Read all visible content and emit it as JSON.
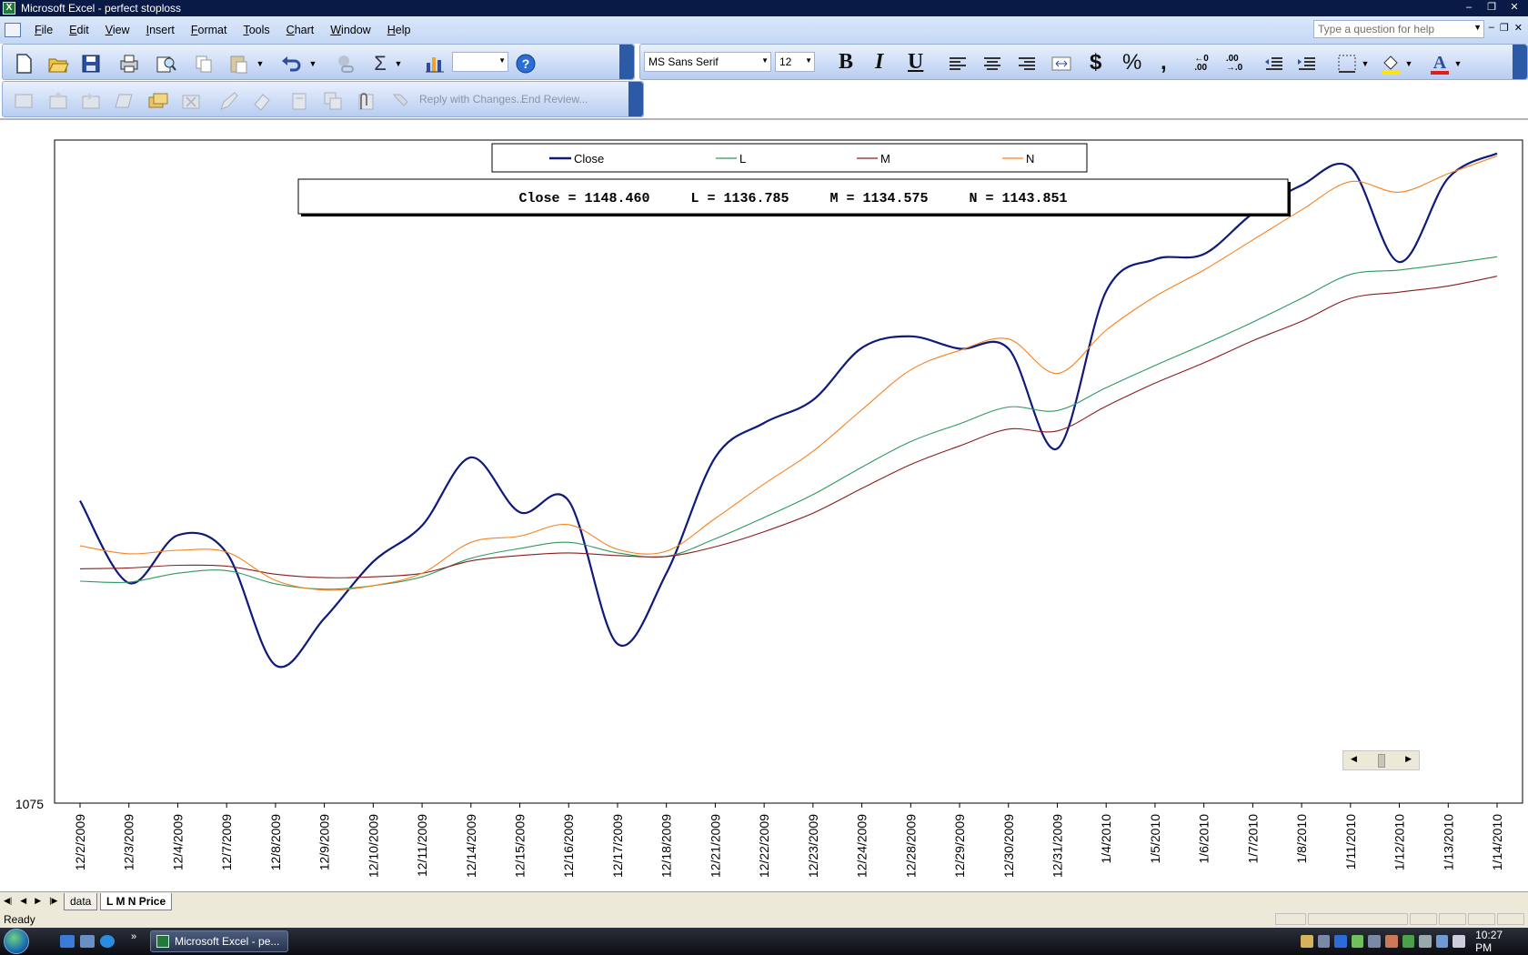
{
  "window": {
    "title": "Microsoft Excel - perfect stoploss"
  },
  "menu": [
    "File",
    "Edit",
    "View",
    "Insert",
    "Format",
    "Tools",
    "Chart",
    "Window",
    "Help"
  ],
  "help_box": {
    "placeholder": "Type a question for help"
  },
  "formatting": {
    "font_name": "MS Sans Serif",
    "font_size": "12",
    "bold": "B",
    "italic": "I",
    "underline": "U",
    "currency": "$",
    "percent": "%",
    "comma": ","
  },
  "review_toolbar": {
    "reply": "Reply with Changes...",
    "end_review": "End Review..."
  },
  "colors": {
    "close": "#0f1a7a",
    "l": "#2e9a5f",
    "m": "#8b1d1d",
    "n": "#f58220"
  },
  "chart_data": {
    "type": "line",
    "categories": [
      "12/2/2009",
      "12/3/2009",
      "12/4/2009",
      "12/7/2009",
      "12/8/2009",
      "12/9/2009",
      "12/10/2009",
      "12/11/2009",
      "12/14/2009",
      "12/15/2009",
      "12/16/2009",
      "12/17/2009",
      "12/18/2009",
      "12/21/2009",
      "12/22/2009",
      "12/23/2009",
      "12/24/2009",
      "12/28/2009",
      "12/29/2009",
      "12/30/2009",
      "12/31/2009",
      "1/4/2010",
      "1/5/2010",
      "1/6/2010",
      "1/7/2010",
      "1/8/2010",
      "1/11/2010",
      "1/12/2010",
      "1/13/2010",
      "1/14/2010"
    ],
    "series": [
      {
        "name": "Close",
        "values": [
          1109.2,
          1099.9,
          1105.3,
          1103.3,
          1090.6,
          1095.9,
          1102.3,
          1106.4,
          1114.1,
          1107.9,
          1109.2,
          1093.0,
          1101.0,
          1114.1,
          1118.0,
          1120.6,
          1126.5,
          1127.8,
          1126.4,
          1126.4,
          1115.1,
          1132.9,
          1136.5,
          1137.1,
          1141.7,
          1144.9,
          1146.9,
          1136.2,
          1145.7,
          1148.5
        ]
      },
      {
        "name": "L",
        "values": [
          1100.1,
          1100.0,
          1101.0,
          1101.3,
          1099.8,
          1099.2,
          1099.6,
          1100.6,
          1102.7,
          1103.8,
          1104.5,
          1103.3,
          1102.9,
          1104.9,
          1107.3,
          1109.9,
          1113.0,
          1115.9,
          1117.9,
          1119.8,
          1119.4,
          1122.0,
          1124.5,
          1126.9,
          1129.4,
          1132.1,
          1134.8,
          1135.3,
          1136.0,
          1136.8
        ]
      },
      {
        "name": "M",
        "values": [
          1101.5,
          1101.6,
          1101.9,
          1101.8,
          1100.9,
          1100.5,
          1100.6,
          1101.0,
          1102.4,
          1103.0,
          1103.3,
          1103.0,
          1102.9,
          1104.0,
          1105.7,
          1107.8,
          1110.6,
          1113.3,
          1115.4,
          1117.3,
          1117.1,
          1119.9,
          1122.5,
          1124.8,
          1127.3,
          1129.5,
          1132.1,
          1132.8,
          1133.5,
          1134.6
        ]
      },
      {
        "name": "N",
        "values": [
          1104.1,
          1103.2,
          1103.6,
          1103.4,
          1100.2,
          1099.1,
          1099.6,
          1101.0,
          1104.5,
          1105.2,
          1106.5,
          1103.7,
          1103.5,
          1107.2,
          1111.1,
          1114.8,
          1119.5,
          1124.0,
          1126.2,
          1127.5,
          1123.6,
          1128.5,
          1132.3,
          1135.3,
          1138.7,
          1142.1,
          1145.3,
          1144.1,
          1146.2,
          1148.2
        ]
      }
    ],
    "ylim": [
      1075,
      1150
    ],
    "y_tick_labels": [
      "1075"
    ],
    "legend_position": "top",
    "annotation": "Close = 1148.460     L = 1136.785     M = 1134.575     N = 1143.851"
  },
  "sheet_tabs": [
    "data",
    "L M  N Price"
  ],
  "status": {
    "text": "Ready"
  },
  "taskbar": {
    "active_window": "Microsoft Excel - pe...",
    "clock": "10:27 PM"
  }
}
